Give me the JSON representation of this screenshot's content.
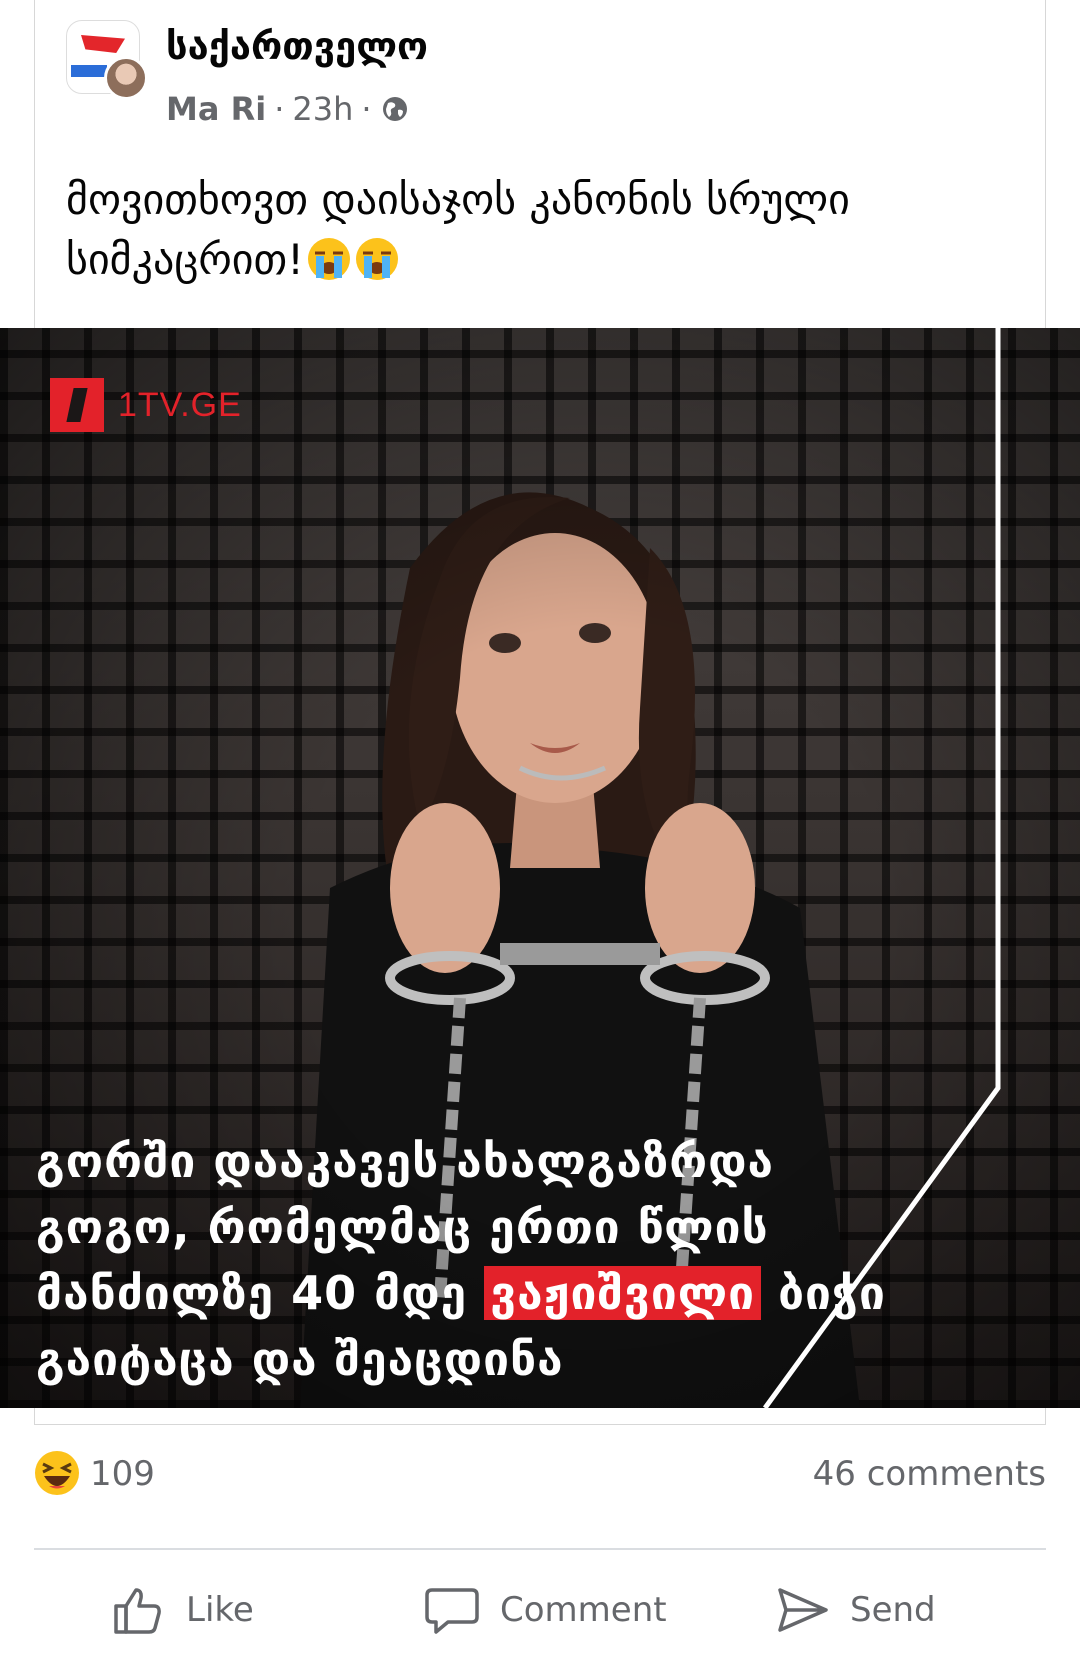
{
  "post": {
    "group_name": "საქართველო",
    "author": "Ma Ri",
    "separator": "·",
    "time": "23h",
    "audience_icon": "globe-icon",
    "text": "მოვითხოვთ დაისაჯოს კანონის სრული სიმკაცრით!",
    "text_emojis": [
      "loudly-crying-face",
      "loudly-crying-face"
    ]
  },
  "image": {
    "logo_text": "1TV.GE",
    "caption_part1": "გორში დააკავეს ახალგაზრდა გოგო, რომელმაც ერთი წლის მანძილზე 40 მდე ",
    "caption_highlight": "ვაჟიშვილი",
    "caption_part2": " ბიჭი გაიტაცა და შეაცდინა",
    "colors": {
      "accent": "#e3222a"
    }
  },
  "stats": {
    "reaction_icon": "haha-emoji-icon",
    "reaction_count": "109",
    "comments": "46 comments"
  },
  "actions": {
    "like": "Like",
    "comment": "Comment",
    "send": "Send"
  },
  "colors": {
    "secondary_text": "#65676b",
    "divider": "#dadde1"
  }
}
